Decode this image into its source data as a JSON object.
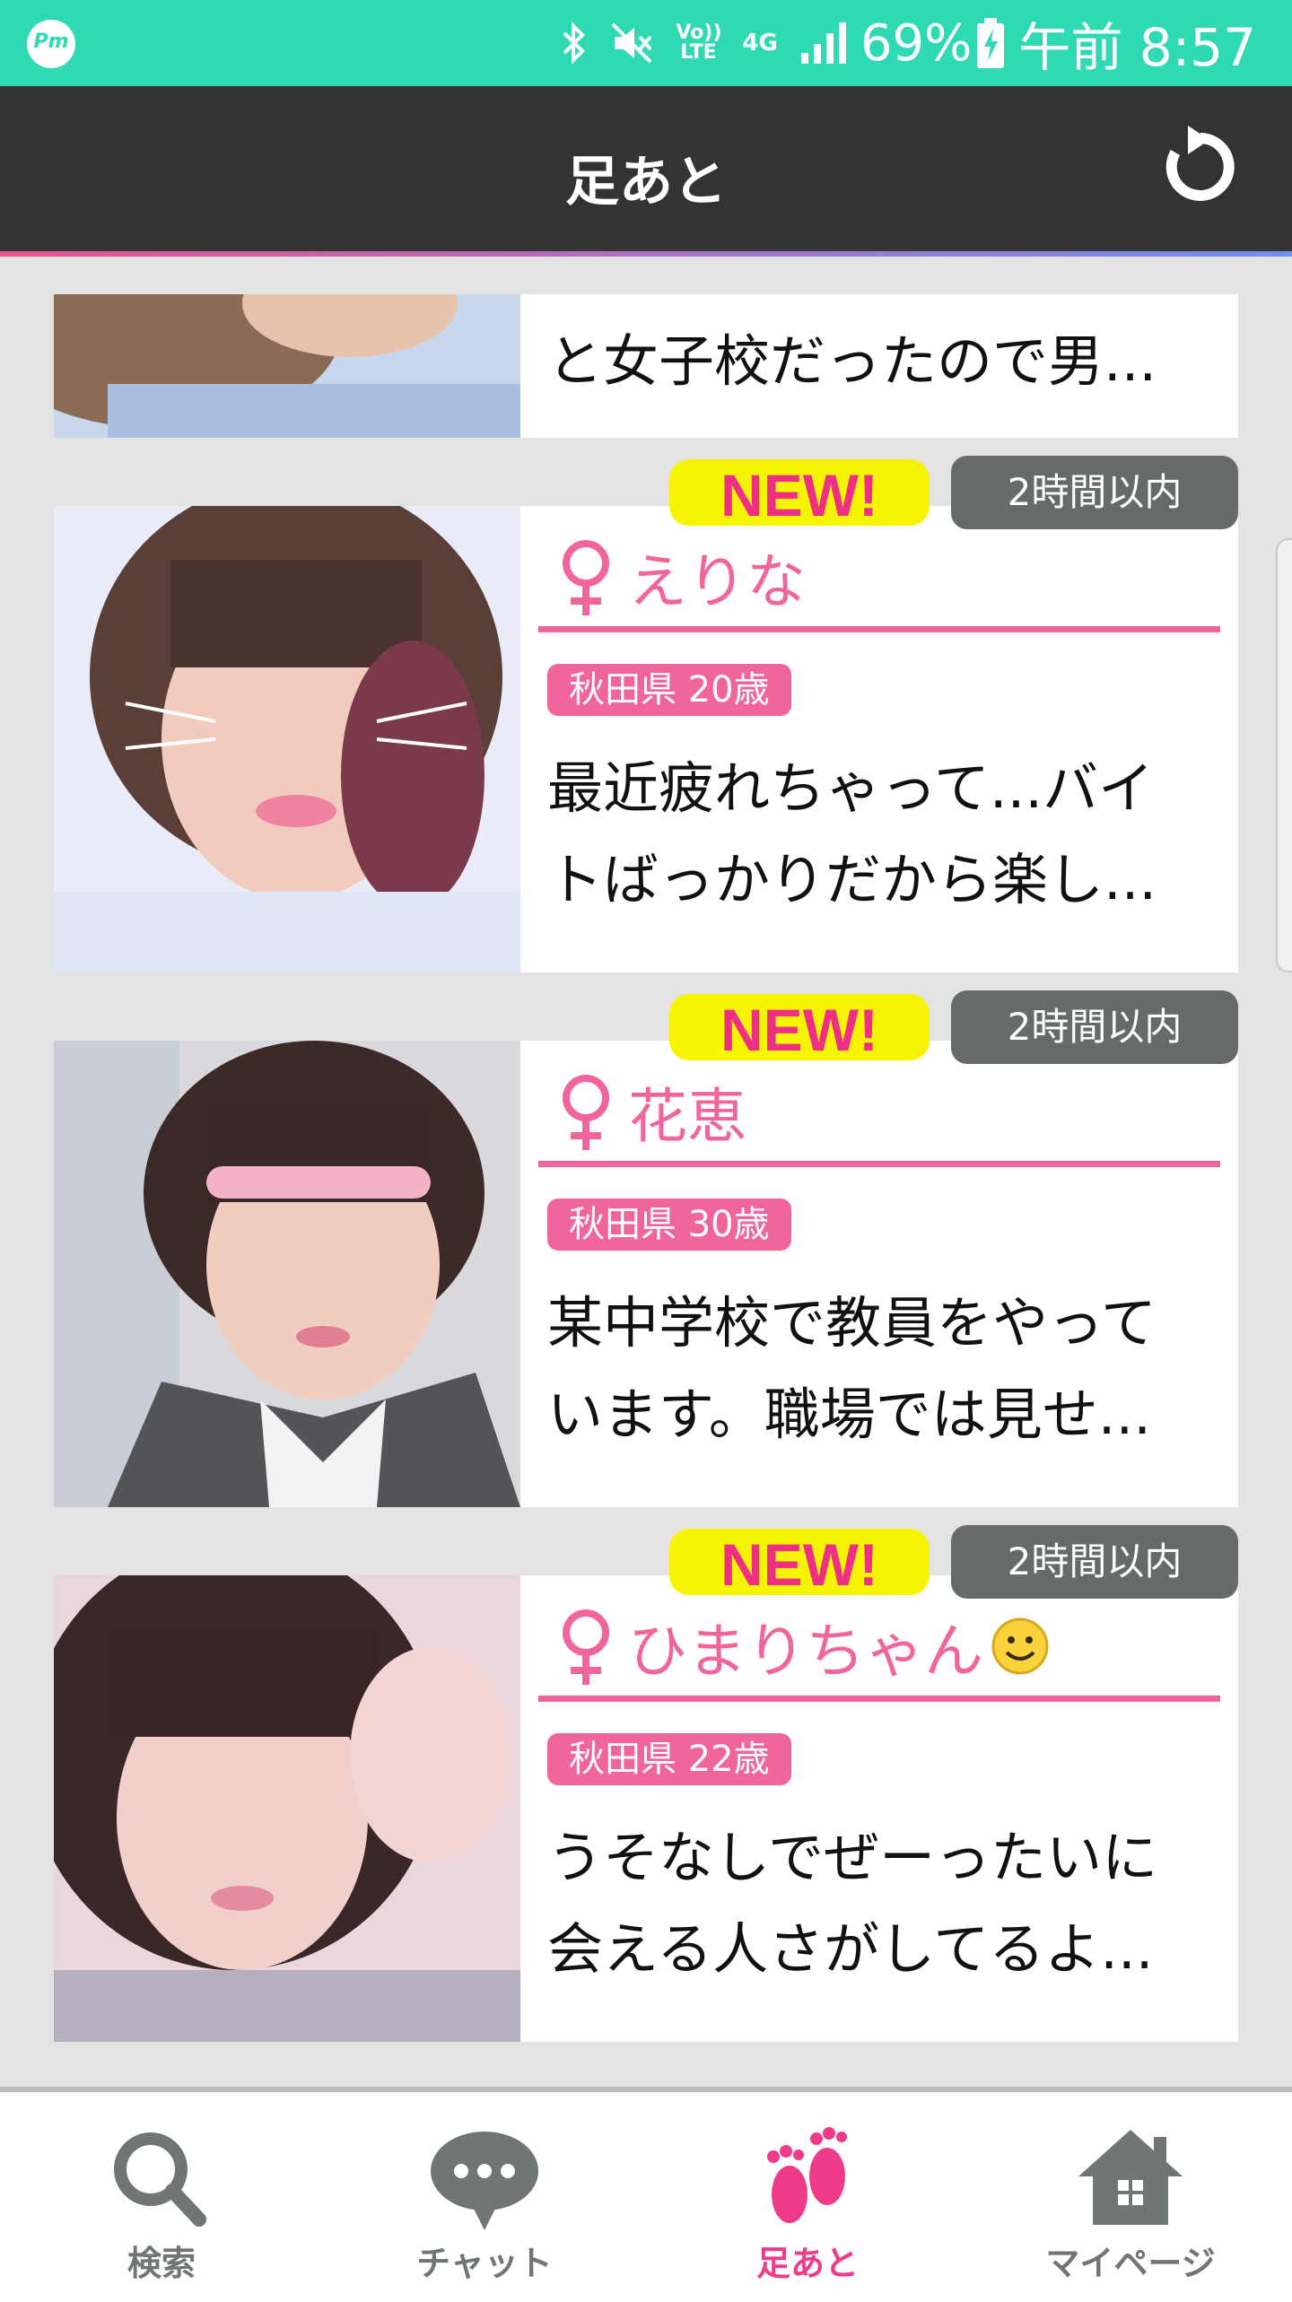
{
  "status_bar": {
    "app_icon_text": "Pm",
    "network_label": "Vo)) LTE",
    "network_type": "4G",
    "battery": "69%",
    "time": "午前 8:57"
  },
  "header": {
    "title": "足あと",
    "refresh_icon": "refresh-icon"
  },
  "list": {
    "partial_item": {
      "message": "と女子校だったので男..."
    },
    "items": [
      {
        "new_label": "NEW!",
        "time": "2時間以内",
        "name": "えりな",
        "has_emoji": false,
        "location_age": "秋田県 20歳",
        "message_line1": "最近疲れちゃって...バイ",
        "message_line2": "トばっかりだから楽し..."
      },
      {
        "new_label": "NEW!",
        "time": "2時間以内",
        "name": "花恵",
        "has_emoji": false,
        "location_age": "秋田県 30歳",
        "message_line1": "某中学校で教員をやって",
        "message_line2": "います。職場では見せ..."
      },
      {
        "new_label": "NEW!",
        "time": "2時間以内",
        "name": "ひまりちゃん",
        "has_emoji": true,
        "location_age": "秋田県 22歳",
        "message_line1": "うそなしでぜーったいに",
        "message_line2": "会える人さがしてるよ..."
      }
    ]
  },
  "bottom_nav": {
    "search": "検索",
    "chat": "チャット",
    "footprints": "足あと",
    "mypage": "マイページ",
    "active": "footprints"
  },
  "colors": {
    "accent": "#f1659d",
    "status_bar": "#2fd9b4",
    "header": "#333333",
    "new_badge": "#f6f400"
  }
}
